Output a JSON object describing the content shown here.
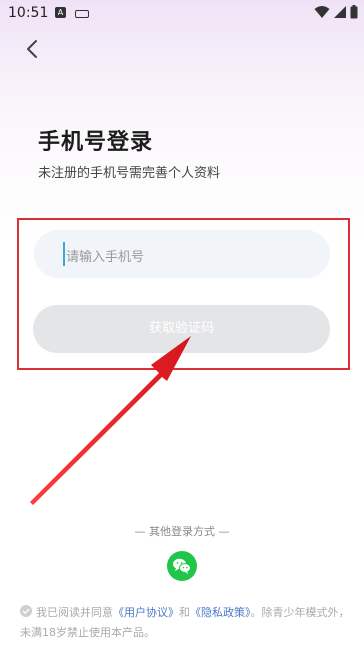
{
  "status_bar": {
    "time": "10:51",
    "notif_letter": "A"
  },
  "page": {
    "title": "手机号登录",
    "subtitle": "未注册的手机号需完善个人资料"
  },
  "phone_input": {
    "placeholder": "请输入手机号"
  },
  "code_button": {
    "label": "获取验证码"
  },
  "other_login": {
    "label": "—   其他登录方式   —"
  },
  "agreement": {
    "prefix": "我已阅读并同意",
    "user_agreement": "《用户协议》",
    "and": "和",
    "privacy_policy": "《隐私政策》",
    "suffix": "。除青少年模式外，未满18岁禁止使用本产品。"
  },
  "colors": {
    "highlight": "#d93036",
    "wechat": "#1fc64a",
    "link": "#4a78c8"
  }
}
